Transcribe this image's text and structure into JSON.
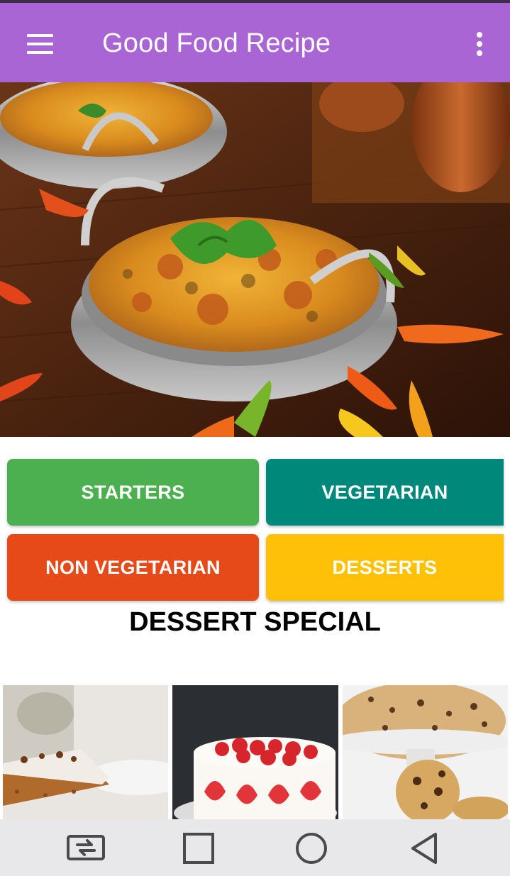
{
  "app_bar": {
    "title": "Good Food Recipe",
    "background_color": "#a865d3",
    "menu_icon": "hamburger-menu-icon",
    "overflow_icon": "more-vert-icon"
  },
  "hero": {
    "subject": "curry dish in bowl with chili peppers"
  },
  "categories": [
    {
      "label": "STARTERS",
      "color": "#4caf50"
    },
    {
      "label": "VEGETARIAN",
      "color": "#00897b"
    },
    {
      "label": "NON VEGETARIAN",
      "color": "#e64a19"
    },
    {
      "label": "DESSERTS",
      "color": "#ffc107"
    }
  ],
  "section": {
    "title": "DESSERT SPECIAL"
  },
  "dessert_thumbnails": [
    {
      "subject": "carrot cake slice"
    },
    {
      "subject": "strawberry cream cake"
    },
    {
      "subject": "chocolate chip cookie cake"
    }
  ],
  "system_nav": {
    "buttons": [
      "recent-apps-switch-icon",
      "square-icon",
      "home-circle-icon",
      "back-triangle-icon"
    ]
  }
}
